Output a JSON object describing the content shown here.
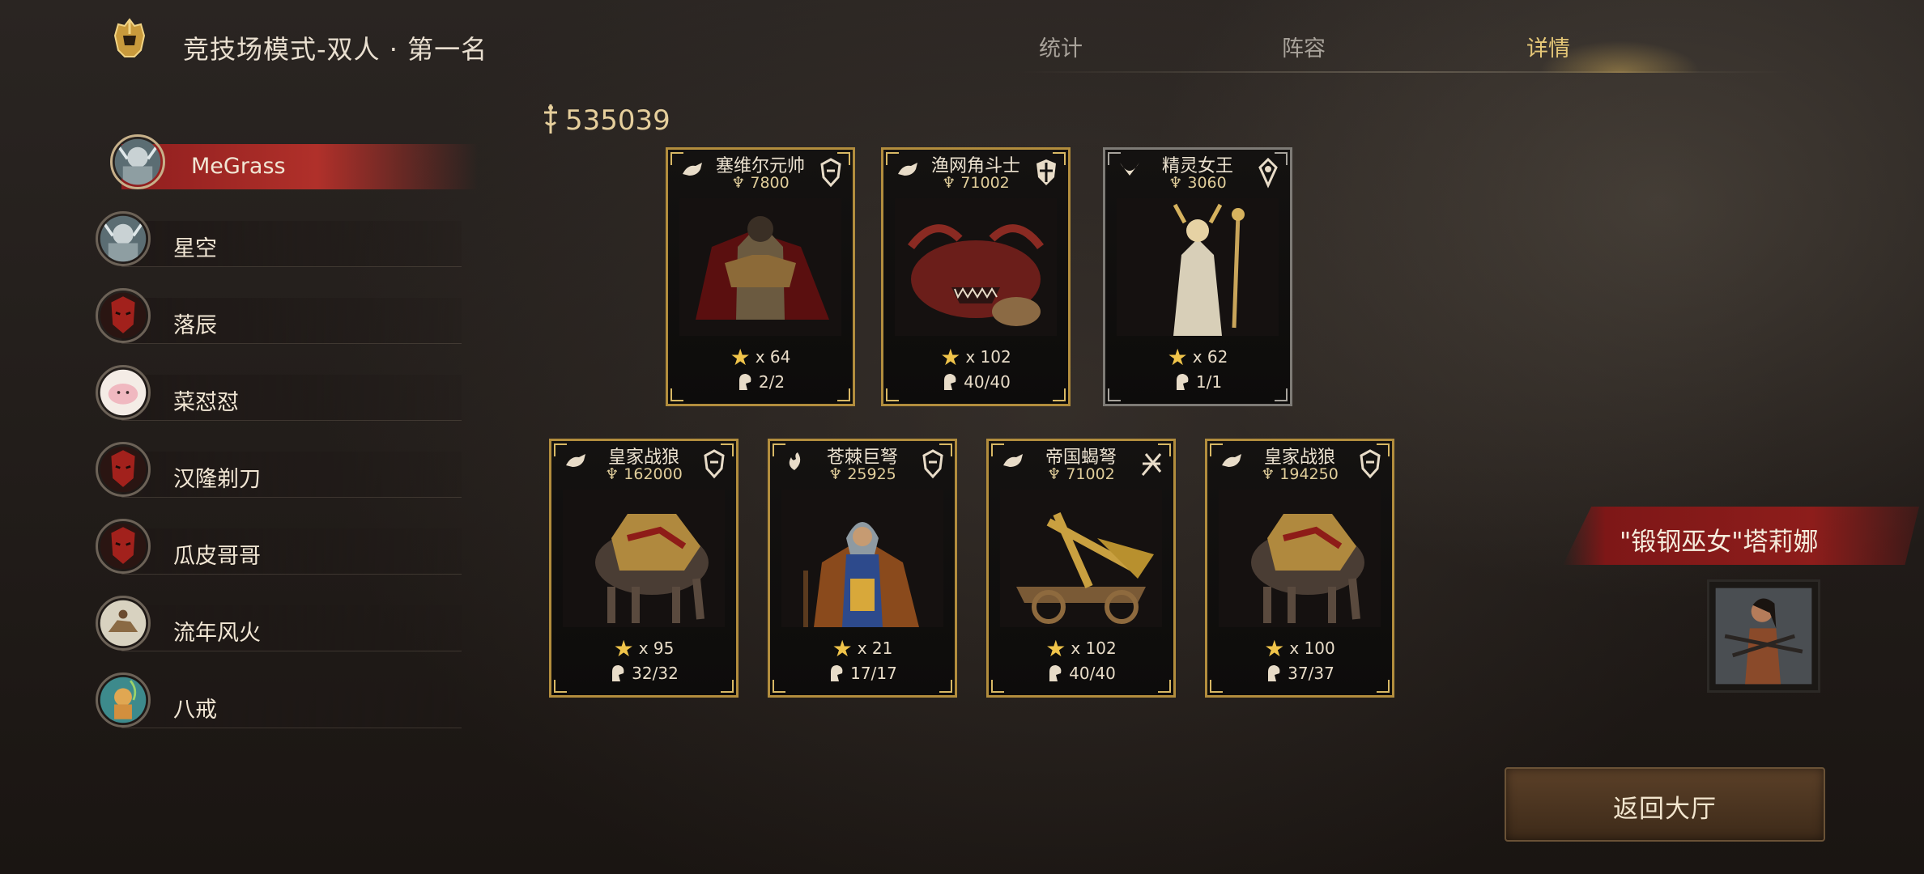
{
  "header": {
    "title": "竞技场模式-双人 · 第一名",
    "tabs": [
      {
        "label": "统计",
        "active": false
      },
      {
        "label": "阵容",
        "active": false
      },
      {
        "label": "详情",
        "active": true
      }
    ]
  },
  "players": [
    {
      "name": "MeGrass",
      "selected": true,
      "avatar": "frost-knight"
    },
    {
      "name": "星空",
      "selected": false,
      "avatar": "frost-knight"
    },
    {
      "name": "落辰",
      "selected": false,
      "avatar": "red-demon"
    },
    {
      "name": "菜怼怼",
      "selected": false,
      "avatar": "pink-creature"
    },
    {
      "name": "汉隆剃刀",
      "selected": false,
      "avatar": "red-demon"
    },
    {
      "name": "瓜皮哥哥",
      "selected": false,
      "avatar": "red-demon"
    },
    {
      "name": "流年风火",
      "selected": false,
      "avatar": "horseman"
    },
    {
      "name": "八戒",
      "selected": false,
      "avatar": "monk"
    }
  ],
  "total_power": "535039",
  "cards": [
    {
      "name": "塞维尔元帅",
      "power": "7800",
      "stars": "x 64",
      "troops": "2/2",
      "frame": "gold",
      "art": "knight"
    },
    {
      "name": "渔网角斗士",
      "power": "71002",
      "stars": "x 102",
      "troops": "40/40",
      "frame": "gold",
      "art": "beast"
    },
    {
      "name": "精灵女王",
      "power": "3060",
      "stars": "x 62",
      "troops": "1/1",
      "frame": "silver",
      "art": "queen"
    },
    {
      "name": "皇家战狼",
      "power": "162000",
      "stars": "x 95",
      "troops": "32/32",
      "frame": "gold",
      "art": "wolf"
    },
    {
      "name": "苍棘巨弩",
      "power": "25925",
      "stars": "x 21",
      "troops": "17/17",
      "frame": "gold",
      "art": "crossbowman"
    },
    {
      "name": "帝国蝎弩",
      "power": "71002",
      "stars": "x 102",
      "troops": "40/40",
      "frame": "gold",
      "art": "ballista"
    },
    {
      "name": "皇家战狼",
      "power": "194250",
      "stars": "x 100",
      "troops": "37/37",
      "frame": "gold",
      "art": "wolf"
    }
  ],
  "hero": {
    "name": "\"锻钢巫女\"塔莉娜"
  },
  "return_button": {
    "label": "返回大厅"
  },
  "colors": {
    "accent_gold": "#e6c878",
    "selected_red": "#b0302a",
    "frame_gold": "#b28d3d"
  }
}
